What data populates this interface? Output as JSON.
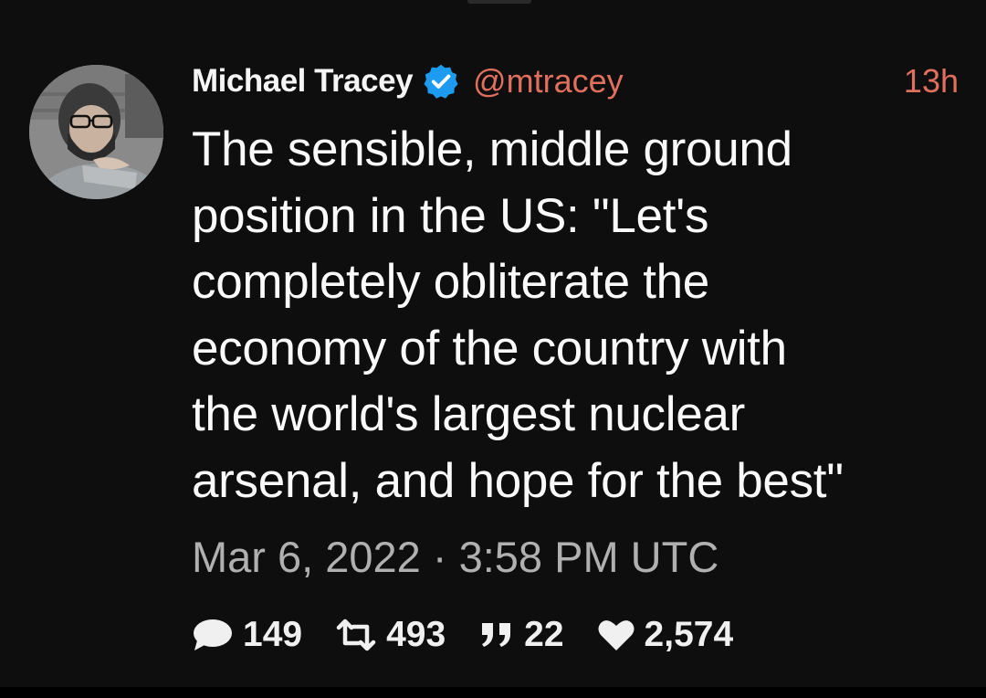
{
  "tweet": {
    "author_name": "Michael Tracey",
    "handle": "@mtracey",
    "time_ago": "13h",
    "verified": true,
    "text": "The sensible, middle ground\nposition in the US: \"Let's\ncompletely obliterate the\neconomy of the country with\nthe world's largest nuclear\narsenal, and hope for the best\"",
    "timestamp": "Mar 6, 2022 · 3:58 PM UTC"
  },
  "stats": {
    "replies": "149",
    "retweets": "493",
    "quotes": "22",
    "likes": "2,574"
  },
  "icons": {
    "verified": "verified-badge-icon",
    "reply": "speech-bubble-icon",
    "retweet": "retweet-icon",
    "quote": "quote-icon",
    "like": "heart-icon"
  },
  "colors": {
    "background": "#0e0e0e",
    "accent": "#e0705e",
    "verified": "#1d9bf0",
    "text": "#fafafa",
    "muted": "#b0b0b0"
  }
}
